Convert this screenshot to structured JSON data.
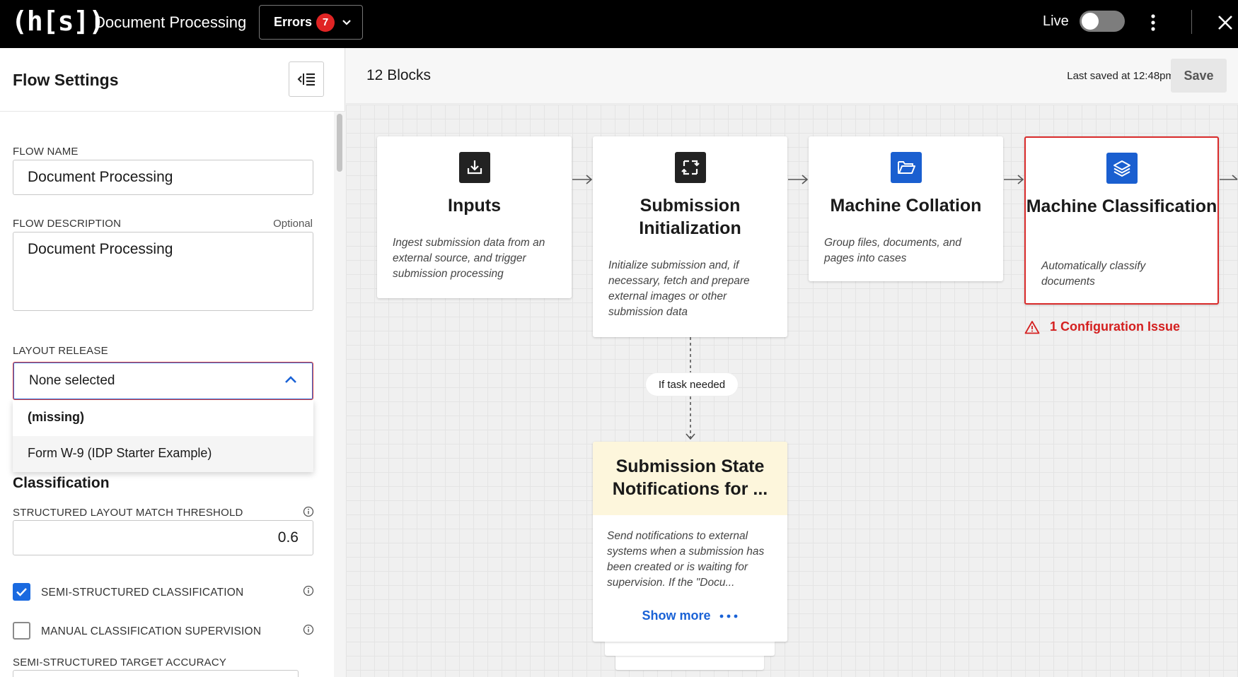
{
  "header": {
    "logo": "(h[s])",
    "app_title": "Document Processing",
    "errors_label": "Errors",
    "errors_count": "7",
    "live_label": "Live",
    "live_on": false
  },
  "settings": {
    "title": "Flow Settings",
    "flow_name_label": "FLOW NAME",
    "flow_name_value": "Document Processing",
    "flow_description_label": "FLOW DESCRIPTION",
    "flow_description_optional": "Optional",
    "flow_description_value": "Document Processing",
    "layout_release_label": "LAYOUT RELEASE",
    "layout_release_value": "None selected",
    "layout_release_options": [
      "(missing)",
      "Form W-9 (IDP Starter Example)"
    ],
    "classification_title": "Classification",
    "threshold_label": "STRUCTURED LAYOUT MATCH THRESHOLD",
    "threshold_value": "0.6",
    "semi_structured_label": "SEMI-STRUCTURED CLASSIFICATION",
    "semi_structured_checked": true,
    "manual_supervision_label": "MANUAL CLASSIFICATION SUPERVISION",
    "manual_supervision_checked": false,
    "target_accuracy_label": "SEMI-STRUCTURED TARGET ACCURACY"
  },
  "canvas": {
    "blocks_count": "12 Blocks",
    "last_saved": "Last saved at 12:48pm",
    "save_label": "Save",
    "blocks": [
      {
        "title": "Inputs",
        "description": "Ingest submission data from an external source, and trigger submission processing"
      },
      {
        "title": "Submission Initialization",
        "description": "Initialize submission and, if necessary, fetch and prepare external images or other submission data"
      },
      {
        "title": "Machine Collation",
        "description": "Group files, documents, and pages into cases"
      },
      {
        "title": "Machine Classification",
        "description": "Automatically classify documents"
      }
    ],
    "config_issue": "1 Configuration Issue",
    "branch_label": "If task needed",
    "notification_block": {
      "title": "Submission State Notifications for ...",
      "description": "Send notifications to external systems when a submission has been created or is waiting for supervision. If the \"Docu...",
      "show_more": "Show more"
    }
  },
  "colors": {
    "accent_blue": "#1a62d6",
    "error_red": "#d92b2b",
    "notification_bg": "#fdf6dc"
  },
  "icons": {
    "inputs": "download-tray-icon",
    "submission_initialization": "transform-icon",
    "machine_collation": "folder-open-icon",
    "machine_classification": "layers-icon"
  }
}
